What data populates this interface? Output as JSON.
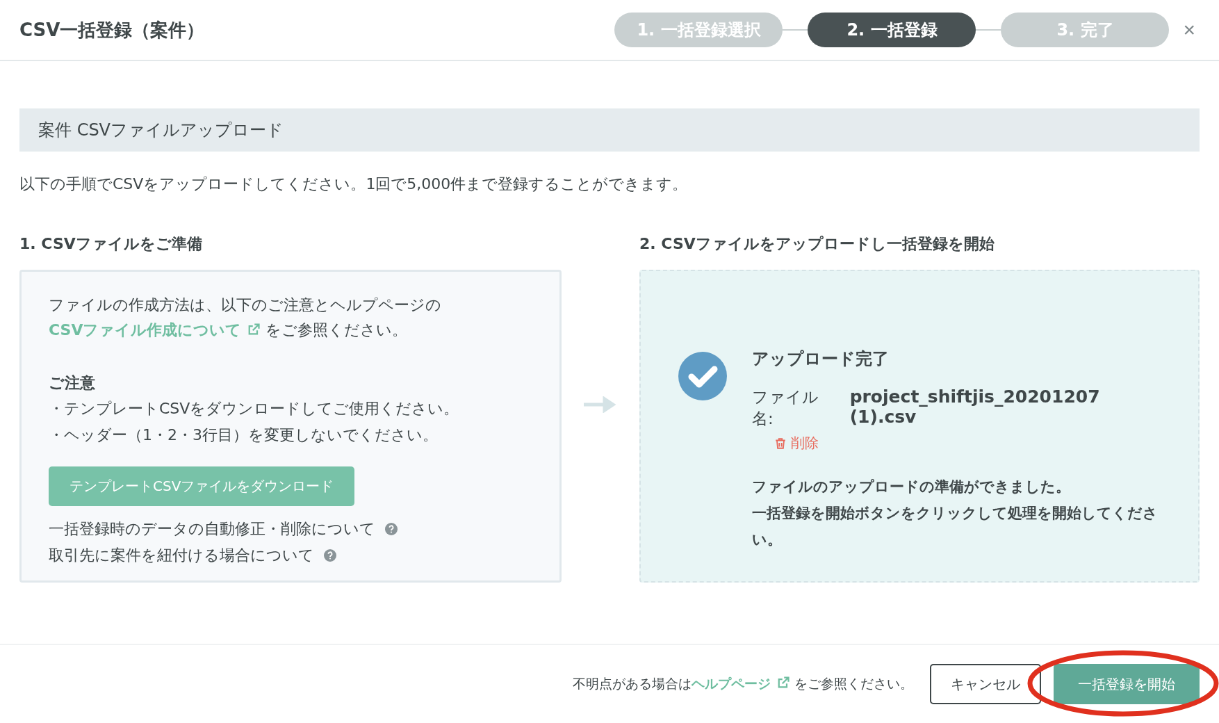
{
  "dialog": {
    "title": "CSV一括登録（案件）",
    "close": "×"
  },
  "steps": [
    {
      "label": "1. 一括登録選択",
      "selected": false
    },
    {
      "label": "2. 一括登録",
      "selected": true
    },
    {
      "label": "3. 完了",
      "selected": false
    }
  ],
  "section_title": "案件 CSVファイルアップロード",
  "intro": "以下の手順でCSVをアップロードしてください。1回で5,000件まで登録することができます。",
  "prepare": {
    "heading": "1. CSVファイルをご準備",
    "text_before": "ファイルの作成方法は、以下のご注意とヘルプページの",
    "link": "CSVファイル作成について",
    "text_after": "をご参照ください。",
    "notice_title": "ご注意",
    "notices": [
      "・テンプレートCSVをダウンロードしてご使用ください。",
      "・ヘッダー（1・2・3行目）を変更しないでください。"
    ],
    "download_button": "テンプレートCSVファイルをダウンロード",
    "help_links": [
      "一括登録時のデータの自動修正・削除について",
      "取引先に案件を紐付ける場合について"
    ]
  },
  "upload": {
    "heading": "2. CSVファイルをアップロードし一括登録を開始",
    "status": "アップロード完了",
    "file_label": "ファイル名:",
    "file_name": "project_shiftjis_20201207 (1).csv",
    "delete": "削除",
    "message": [
      "ファイルのアップロードの準備ができました。",
      "一括登録を開始ボタンをクリックして処理を開始してください。"
    ]
  },
  "footer": {
    "help_before": "不明点がある場合は",
    "help_link": "ヘルプページ",
    "help_after": "をご参照ください。",
    "cancel": "キャンセル",
    "start": "一括登録を開始"
  }
}
